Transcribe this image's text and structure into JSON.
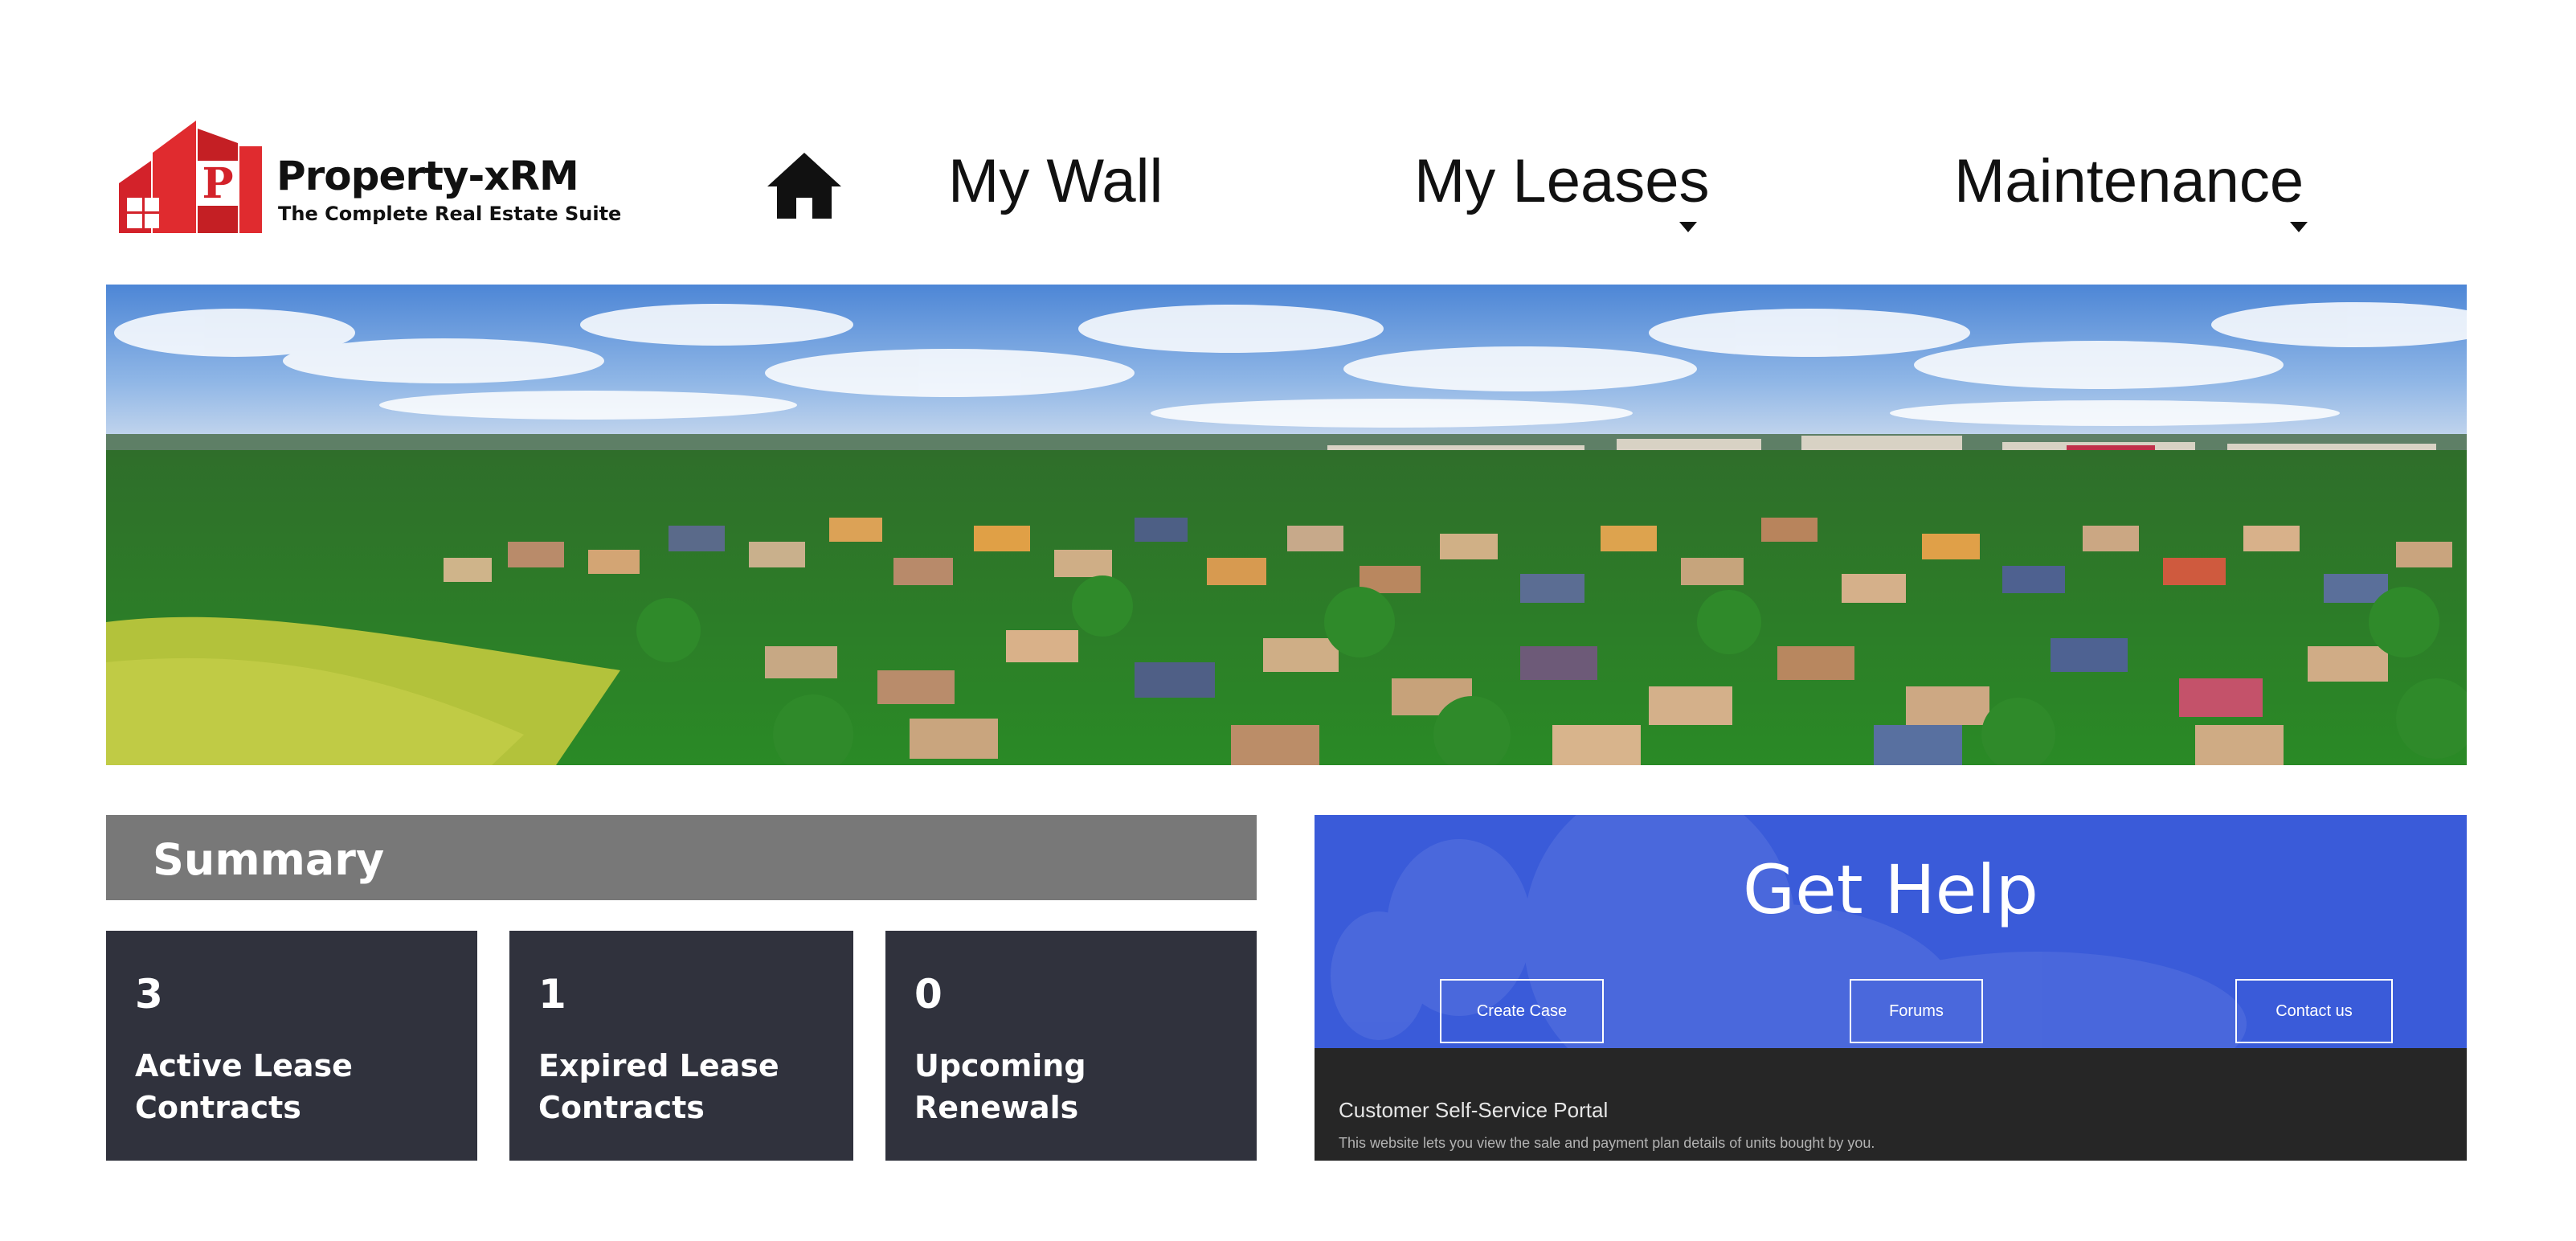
{
  "brand": {
    "name": "Property-xRM",
    "tagline": "The Complete Real Estate Suite",
    "logo_letter": "P",
    "color": "#d3222a"
  },
  "nav": {
    "home_icon": "home-icon",
    "items": [
      {
        "label": "My Wall",
        "has_dropdown": false
      },
      {
        "label": "My Leases",
        "has_dropdown": true
      },
      {
        "label": "Maintenance",
        "has_dropdown": true
      }
    ]
  },
  "summary": {
    "title": "Summary",
    "tiles": [
      {
        "count": "3",
        "label": "Active Lease Contracts"
      },
      {
        "count": "1",
        "label": "Expired Lease Contracts"
      },
      {
        "count": "0",
        "label": "Upcoming Renewals"
      }
    ]
  },
  "help": {
    "title": "Get Help",
    "buttons": [
      "Create Case",
      "Forums",
      "Contact us"
    ],
    "portal_title": "Customer Self-Service Portal",
    "portal_description": "This website lets you view the sale and payment plan details of units bought by you."
  },
  "colors": {
    "summary_header": "#787878",
    "tile_bg": "#30323d",
    "help_bg": "#3a5bd9",
    "footer_bg": "#262626"
  }
}
